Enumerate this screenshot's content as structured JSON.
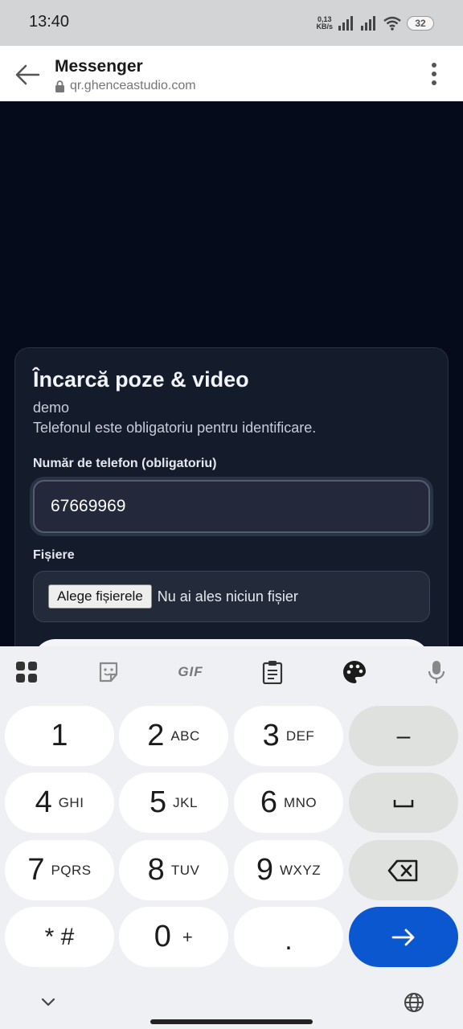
{
  "status_bar": {
    "time": "13:40",
    "net_speed_value": "0,13",
    "net_speed_unit": "KB/s",
    "battery": "32"
  },
  "app_bar": {
    "title": "Messenger",
    "url": "qr.ghenceastudio.com"
  },
  "form": {
    "title": "Încarcă poze & video",
    "subtitle": "demo",
    "note": "Telefonul este obligatoriu pentru identificare.",
    "phone_label": "Număr de telefon (obligatoriu)",
    "phone_value": "67669969",
    "files_label": "Fișiere",
    "file_button": "Alege fișierele",
    "file_status": "Nu ai ales niciun fișier"
  },
  "keyboard": {
    "toolbar": [
      "apps-icon",
      "sticker-icon",
      "gif",
      "clipboard-icon",
      "palette-icon",
      "mic-icon"
    ],
    "gif_label": "GIF",
    "keys": [
      {
        "main": "1",
        "sub": ""
      },
      {
        "main": "2",
        "sub": "ABC"
      },
      {
        "main": "3",
        "sub": "DEF"
      },
      {
        "main": "–",
        "sub": ""
      },
      {
        "main": "4",
        "sub": "GHI"
      },
      {
        "main": "5",
        "sub": "JKL"
      },
      {
        "main": "6",
        "sub": "MNO"
      },
      {
        "main": "7",
        "sub": "PQRS"
      },
      {
        "main": "8",
        "sub": "TUV"
      },
      {
        "main": "9",
        "sub": "WXYZ"
      },
      {
        "main": "* #",
        "sub": ""
      },
      {
        "main": "0",
        "sub": "+"
      },
      {
        "main": ".",
        "sub": ""
      }
    ]
  },
  "colors": {
    "page_bg": "#060b1c",
    "card_bg": "#141b2b",
    "accent": "#0b57d0"
  }
}
